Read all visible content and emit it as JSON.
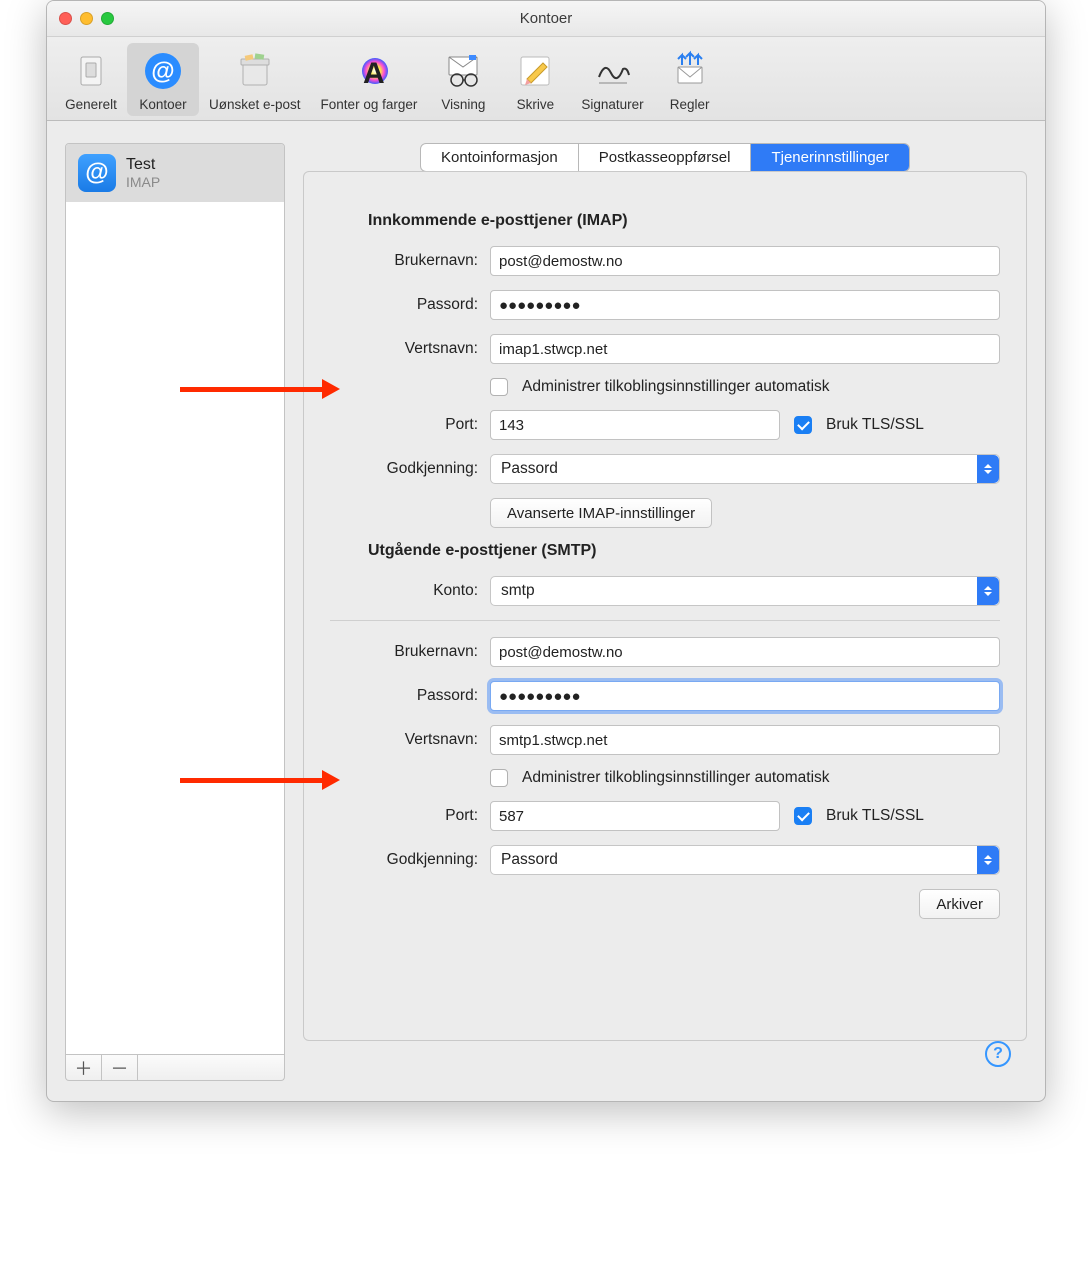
{
  "window": {
    "title": "Kontoer"
  },
  "toolbar": {
    "items": [
      {
        "label": "Generelt"
      },
      {
        "label": "Kontoer"
      },
      {
        "label": "Uønsket e-post"
      },
      {
        "label": "Fonter og farger"
      },
      {
        "label": "Visning"
      },
      {
        "label": "Skrive"
      },
      {
        "label": "Signaturer"
      },
      {
        "label": "Regler"
      }
    ]
  },
  "sidebar": {
    "account": {
      "name": "Test",
      "type": "IMAP",
      "badge": "@"
    },
    "add": "＋",
    "remove": "－"
  },
  "tabs": {
    "info": "Kontoinformasjon",
    "mailbox": "Postkasseoppførsel",
    "server": "Tjenerinnstillinger"
  },
  "incoming": {
    "section_title": "Innkommende e-posttjener (IMAP)",
    "username_label": "Brukernavn:",
    "username": "post@demostw.no",
    "password_label": "Passord:",
    "password": "●●●●●●●●●",
    "host_label": "Vertsnavn:",
    "host": "imap1.stwcp.net",
    "auto_label": "Administrer tilkoblingsinnstillinger automatisk",
    "port_label": "Port:",
    "port": "143",
    "tls_label": "Bruk TLS/SSL",
    "auth_label": "Godkjenning:",
    "auth_value": "Passord",
    "advanced_button": "Avanserte IMAP-innstillinger"
  },
  "outgoing": {
    "section_title": "Utgående e-posttjener (SMTP)",
    "account_label": "Konto:",
    "account_value": "smtp",
    "username_label": "Brukernavn:",
    "username": "post@demostw.no",
    "password_label": "Passord:",
    "password": "●●●●●●●●●",
    "host_label": "Vertsnavn:",
    "host": "smtp1.stwcp.net",
    "auto_label": "Administrer tilkoblingsinnstillinger automatisk",
    "port_label": "Port:",
    "port": "587",
    "tls_label": "Bruk TLS/SSL",
    "auth_label": "Godkjenning:",
    "auth_value": "Passord"
  },
  "save_button": "Arkiver",
  "help": "?"
}
